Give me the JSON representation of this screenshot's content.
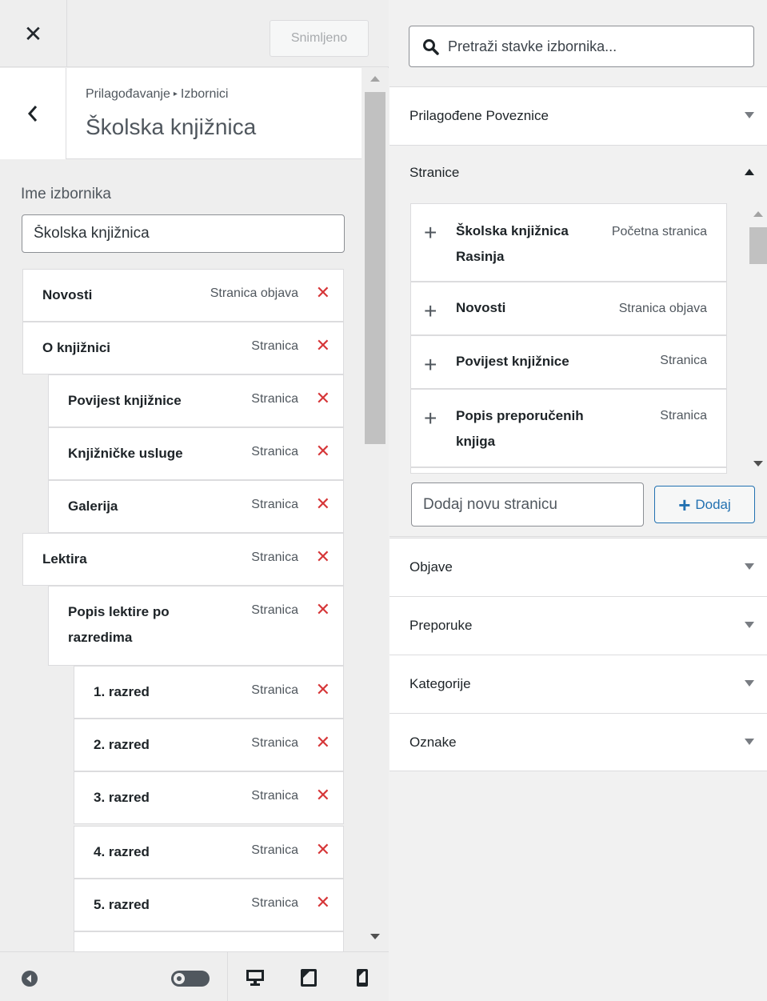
{
  "toolbar": {
    "saved_label": "Snimljeno"
  },
  "header": {
    "breadcrumb_root": "Prilagođavanje",
    "breadcrumb_sep": "▸",
    "breadcrumb_current": "Izbornici",
    "title": "Školska knjižnica"
  },
  "menu": {
    "name_label": "Ime izbornika",
    "name_value": "Školska knjižnica",
    "items": [
      {
        "title": "Novosti",
        "type": "Stranica objava"
      },
      {
        "title": "O knjižnici",
        "type": "Stranica"
      },
      {
        "title": "Povijest knjižnice",
        "type": "Stranica"
      },
      {
        "title": "Knjižničke usluge",
        "type": "Stranica"
      },
      {
        "title": "Galerija",
        "type": "Stranica"
      },
      {
        "title": "Lektira",
        "type": "Stranica"
      },
      {
        "title": "Popis lektire po",
        "title2": "razredima",
        "type": "Stranica"
      },
      {
        "title": "1. razred",
        "type": "Stranica"
      },
      {
        "title": "2. razred",
        "type": "Stranica"
      },
      {
        "title": "3. razred",
        "type": "Stranica"
      },
      {
        "title": "4. razred",
        "type": "Stranica"
      },
      {
        "title": "5. razred",
        "type": "Stranica"
      }
    ],
    "delete_glyph": "✕"
  },
  "search": {
    "placeholder": "Pretraži stavke izbornika..."
  },
  "sections": {
    "custom_links": "Prilagođene Poveznice",
    "pages": "Stranice",
    "posts": "Objave",
    "recommendations": "Preporuke",
    "categories": "Kategorije",
    "tags": "Oznake"
  },
  "pages": {
    "items": [
      {
        "title": "Školska knjižnica",
        "title2": "Rasinja",
        "type": "Početna stranica"
      },
      {
        "title": "Novosti",
        "type": "Stranica objava"
      },
      {
        "title": "Povijest knjižnice",
        "type": "Stranica"
      },
      {
        "title": "Popis preporučenih",
        "title2": "knjiga",
        "type": "Stranica"
      }
    ],
    "new_placeholder": "Dodaj novu stranicu",
    "add_label": "Dodaj"
  },
  "colors": {
    "accent": "#2271b1",
    "danger": "#d63638"
  }
}
